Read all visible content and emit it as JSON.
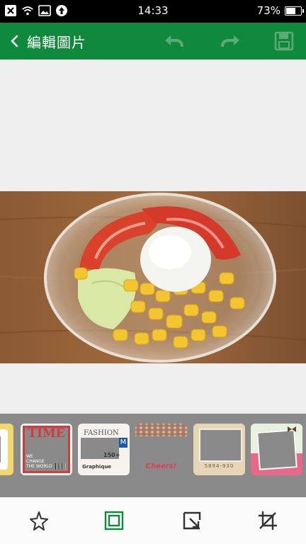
{
  "status_bar": {
    "time": "14:33",
    "battery": "73%",
    "battery_level": 0.73,
    "icons": [
      "close-notification-icon",
      "wifi-icon",
      "image-notification-icon",
      "upload-icon"
    ]
  },
  "app_bar": {
    "back_icon": "chevron-left-icon",
    "title": "編輯圖片",
    "undo_icon": "undo-icon",
    "redo_icon": "redo-icon",
    "save_icon": "floppy-save-icon"
  },
  "frames": [
    {
      "name": "polka-frame",
      "text": ""
    },
    {
      "name": "time-magazine-frame",
      "title": "TIME",
      "subtitle_1": "WE",
      "subtitle_2": "CHANGE",
      "subtitle_3": "THE WORLD"
    },
    {
      "name": "fashion-magazine-frame",
      "title": "FASHION",
      "badge": "M",
      "number": "150+",
      "footer": "Graphique"
    },
    {
      "name": "cheers-frame",
      "text": "Cheers!"
    },
    {
      "name": "polaroid-frame",
      "text": "5894-930"
    },
    {
      "name": "bow-frame",
      "text": ""
    }
  ],
  "bottom_tools": [
    {
      "name": "effects-tool",
      "icon": "sparkle-star-icon",
      "active": false
    },
    {
      "name": "frame-tool",
      "icon": "frame-icon",
      "active": true
    },
    {
      "name": "sticker-tool",
      "icon": "arrow-select-icon",
      "active": false
    },
    {
      "name": "crop-tool",
      "icon": "crop-icon",
      "active": false
    }
  ],
  "colors": {
    "primary": "#0f8a3c",
    "active_tool": "#0f8a3c",
    "inactive_tool": "#333333",
    "disabled_action": "#5cab76"
  }
}
